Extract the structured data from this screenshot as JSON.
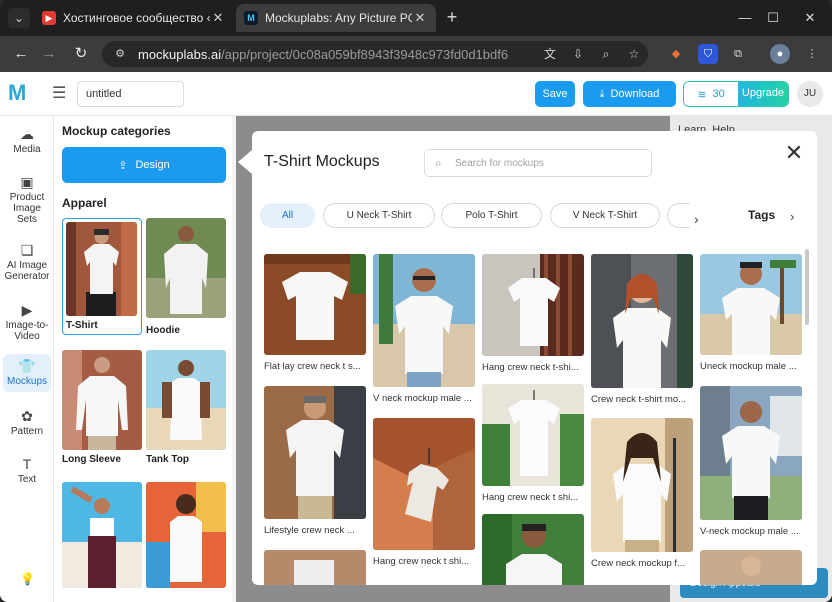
{
  "browser": {
    "tabs": [
      {
        "title": "Хостинговое сообщество «Tim",
        "favicon": "youtube-icon"
      },
      {
        "title": "Mockuplabs: Any Picture POD",
        "favicon": "mockuplabs-icon"
      }
    ],
    "url_host": "mockuplabs.ai",
    "url_path": "/app/project/0c08a059bf8943f3948c973fd0d1bdf6"
  },
  "app": {
    "title_value": "untitled",
    "save_label": "Save",
    "download_label": "Download",
    "credits": "30",
    "upgrade_label": "Upgrade",
    "avatar_initials": "JU"
  },
  "rail": [
    {
      "label": "Media",
      "icon": "cloud-upload-icon"
    },
    {
      "label": "Product Image Sets",
      "icon": "image-icon"
    },
    {
      "label": "AI Image Generator",
      "icon": "ai-icon"
    },
    {
      "label": "Image-to-Video",
      "icon": "video-icon"
    },
    {
      "label": "Mockups",
      "icon": "tshirt-icon"
    },
    {
      "label": "Pattern",
      "icon": "pattern-icon"
    },
    {
      "label": "Text",
      "icon": "text-icon"
    }
  ],
  "categories": {
    "title": "Mockup categories",
    "design_label": "Design",
    "section": "Apparel",
    "items": [
      {
        "label": "T-Shirt"
      },
      {
        "label": "Hoodie"
      },
      {
        "label": "Long Sleeve"
      },
      {
        "label": "Tank Top"
      },
      {
        "label": ""
      },
      {
        "label": ""
      }
    ]
  },
  "right_panel": {
    "tab_learn": "Learn",
    "tab_help": "Help",
    "banner": "Design Appears"
  },
  "modal": {
    "title": "T-Shirt Mockups",
    "search_placeholder": "Search for mockups",
    "chips": [
      "All",
      "U Neck T-Shirt",
      "Polo T-Shirt",
      "V Neck T-Shirt"
    ],
    "tags_label": "Tags",
    "cards": [
      {
        "caption": "Flat lay crew neck t s..."
      },
      {
        "caption": "Lifestyle crew neck ..."
      },
      {
        "caption": ""
      },
      {
        "caption": "V neck mockup male ..."
      },
      {
        "caption": "Hang crew neck t shi..."
      },
      {
        "caption": "Hang crew neck t-shi..."
      },
      {
        "caption": "Hang crew neck t shi..."
      },
      {
        "caption": ""
      },
      {
        "caption": "Crew neck t-shirt mo..."
      },
      {
        "caption": "Crew neck mockup f..."
      },
      {
        "caption": "Uneck mockup male ..."
      },
      {
        "caption": "V-neck mockup male ..."
      },
      {
        "caption": ""
      }
    ]
  }
}
